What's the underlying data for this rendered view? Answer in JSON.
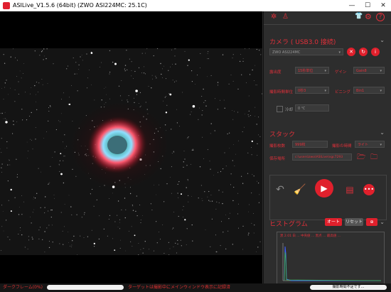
{
  "window": {
    "title": "ASILive_V1.5.6 (64bit)  (ZWO ASI224MC: 25.1C)",
    "minimize": "—",
    "maximize": "☐",
    "close": "✕"
  },
  "header_icons": {
    "settings": "✲",
    "user": "♙",
    "shirt": "👕",
    "gear": "⚙",
    "help": "?"
  },
  "camera": {
    "title": "カメラ ( USB3.0 接続)",
    "model": "ZWO ASI224MC",
    "gain_label": "露出度",
    "gain_value": "15秒単位",
    "gain_right_label": "ゲイン",
    "gain_right_value": "Gain8",
    "exposure_label": "撮影時間単位",
    "exposure_value": "0秒3",
    "binning_label": "ビニング",
    "binning_value": "Bin1",
    "cooler_label": "冷却",
    "cooler_value": "0 ℃"
  },
  "stack": {
    "title": "スタック",
    "frames_label": "撮影枚数",
    "frames_value": "999枚",
    "time_label": "撮影の時間",
    "time_value": "ライト",
    "save_label": "保存場所",
    "save_path": "c:\\users\\zwo\\ASILive\\ngc7293"
  },
  "histogram": {
    "title": "ヒストグラム",
    "auto_label": "オート",
    "reset_label": "リセット",
    "info": "黒 2.01 白 ... 中央値 ... 黒点 ... 最高値 ..."
  },
  "status": {
    "left_text": "ダークフレーム(0%)",
    "mid_text": "ターゲットは撮影中にメインウィンドウ表示に記録済",
    "right_text": "撮影時間不足です..."
  },
  "colors": {
    "accent": "#e0303a",
    "panel_bg": "#2d2d2d",
    "viewer_bg": "#000000"
  }
}
